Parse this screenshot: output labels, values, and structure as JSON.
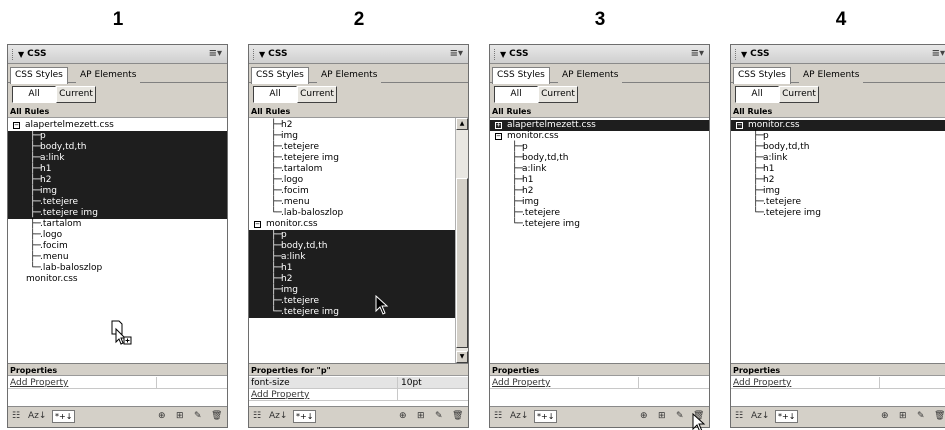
{
  "step_numbers": [
    "1",
    "2",
    "3",
    "4"
  ],
  "panel": {
    "title": "CSS",
    "title_arrow": "▼",
    "tabs": {
      "active": "CSS Styles",
      "inactive": "AP Elements"
    },
    "toggle": {
      "all": "All",
      "current": "Current"
    },
    "rules_header": "All Rules",
    "add_property": "Add Property",
    "bottom": {
      "cat_icon": "☷",
      "az_icon": "Az↓",
      "set_icon": "*+↓",
      "link_icon": "⊕",
      "new_icon": "⊞",
      "edit_icon": "✎",
      "trash_icon": "🗑"
    }
  },
  "panels": [
    {
      "properties_header": "Properties",
      "props": [],
      "rows": [
        {
          "text": "alapertelmezett.css",
          "type": "file",
          "exp": "−",
          "sel": false
        },
        {
          "text": "p",
          "type": "rule",
          "sel": true
        },
        {
          "text": "body,td,th",
          "type": "rule",
          "sel": true
        },
        {
          "text": "a:link",
          "type": "rule",
          "sel": true
        },
        {
          "text": "h1",
          "type": "rule",
          "sel": true
        },
        {
          "text": "h2",
          "type": "rule",
          "sel": true
        },
        {
          "text": "img",
          "type": "rule",
          "sel": true
        },
        {
          "text": ".tetejere",
          "type": "rule",
          "sel": true
        },
        {
          "text": ".tetejere img",
          "type": "rule",
          "sel": true
        },
        {
          "text": ".tartalom",
          "type": "rule",
          "sel": false
        },
        {
          "text": ".logo",
          "type": "rule",
          "sel": false
        },
        {
          "text": ".focim",
          "type": "rule",
          "sel": false
        },
        {
          "text": ".menu",
          "type": "rule",
          "sel": false
        },
        {
          "text": ".lab-baloszlop",
          "type": "rule",
          "last": true,
          "sel": false
        },
        {
          "text": "monitor.css",
          "type": "plain",
          "sel": false
        }
      ]
    },
    {
      "properties_header": "Properties for \"p\"",
      "props": [
        {
          "key": "font-size",
          "value": "10pt"
        }
      ],
      "rows": [
        {
          "text": "h2",
          "type": "rule",
          "sel": false
        },
        {
          "text": "img",
          "type": "rule",
          "sel": false
        },
        {
          "text": ".tetejere",
          "type": "rule",
          "sel": false
        },
        {
          "text": ".tetejere img",
          "type": "rule",
          "sel": false
        },
        {
          "text": ".tartalom",
          "type": "rule",
          "sel": false
        },
        {
          "text": ".logo",
          "type": "rule",
          "sel": false
        },
        {
          "text": ".focim",
          "type": "rule",
          "sel": false
        },
        {
          "text": ".menu",
          "type": "rule",
          "sel": false
        },
        {
          "text": ".lab-baloszlop",
          "type": "rule",
          "last": true,
          "sel": false
        },
        {
          "text": "monitor.css",
          "type": "file",
          "exp": "−",
          "sel": false
        },
        {
          "text": "p",
          "type": "rule",
          "sel": true
        },
        {
          "text": "body,td,th",
          "type": "rule",
          "sel": true
        },
        {
          "text": "a:link",
          "type": "rule",
          "sel": true
        },
        {
          "text": "h1",
          "type": "rule",
          "sel": true
        },
        {
          "text": "h2",
          "type": "rule",
          "sel": true
        },
        {
          "text": "img",
          "type": "rule",
          "sel": true
        },
        {
          "text": ".tetejere",
          "type": "rule",
          "sel": true
        },
        {
          "text": ".tetejere img",
          "type": "rule",
          "last": true,
          "sel": true
        }
      ]
    },
    {
      "properties_header": "Properties",
      "props": [],
      "rows": [
        {
          "text": "alapertelmezett.css",
          "type": "file",
          "exp": "+",
          "sel": true
        },
        {
          "text": "monitor.css",
          "type": "file",
          "exp": "−",
          "sel": false
        },
        {
          "text": "p",
          "type": "rule",
          "sel": false
        },
        {
          "text": "body,td,th",
          "type": "rule",
          "sel": false
        },
        {
          "text": "a:link",
          "type": "rule",
          "sel": false
        },
        {
          "text": "h1",
          "type": "rule",
          "sel": false
        },
        {
          "text": "h2",
          "type": "rule",
          "sel": false
        },
        {
          "text": "img",
          "type": "rule",
          "sel": false
        },
        {
          "text": ".tetejere",
          "type": "rule",
          "sel": false
        },
        {
          "text": ".tetejere img",
          "type": "rule",
          "last": true,
          "sel": false
        }
      ]
    },
    {
      "properties_header": "Properties",
      "props": [],
      "rows": [
        {
          "text": "monitor.css",
          "type": "file",
          "exp": "−",
          "sel": true
        },
        {
          "text": "p",
          "type": "rule",
          "sel": false
        },
        {
          "text": "body,td,th",
          "type": "rule",
          "sel": false
        },
        {
          "text": "a:link",
          "type": "rule",
          "sel": false
        },
        {
          "text": "h1",
          "type": "rule",
          "sel": false
        },
        {
          "text": "h2",
          "type": "rule",
          "sel": false
        },
        {
          "text": "img",
          "type": "rule",
          "sel": false
        },
        {
          "text": ".tetejere",
          "type": "rule",
          "sel": false
        },
        {
          "text": ".tetejere img",
          "type": "rule",
          "last": true,
          "sel": false
        }
      ]
    }
  ]
}
